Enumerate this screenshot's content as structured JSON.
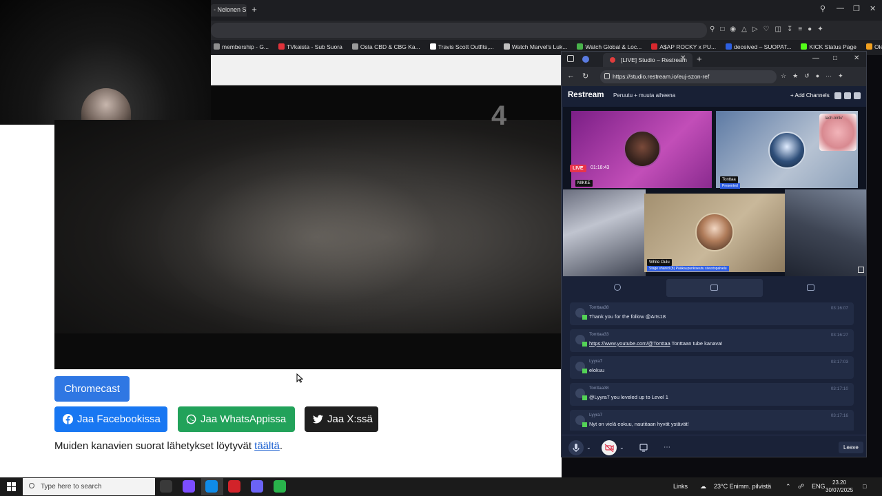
{
  "background_browser": {
    "tab_title": "- Nelonen Su",
    "bookmarks": [
      {
        "label": "membership - G...",
        "color": "#8e8e8e"
      },
      {
        "label": "TVkaista - Sub Suora",
        "color": "#e0323a"
      },
      {
        "label": "Osta CBD & CBG Ka...",
        "color": "#9a9a9a"
      },
      {
        "label": "Travis Scott Outfits,...",
        "color": "#ffffff"
      },
      {
        "label": "Watch Marvel's Luk...",
        "color": "#bfbfbf"
      },
      {
        "label": "Watch Global & Loc...",
        "color": "#49b34b"
      },
      {
        "label": "A$AP ROCKY x PU...",
        "color": "#d8282e"
      },
      {
        "label": "deceived – SUOPAT...",
        "color": "#2d5fe0"
      },
      {
        "label": "KICK Status Page",
        "color": "#53fc18"
      },
      {
        "label": "Oleksandr Usyk vs D...",
        "color": "#f0a020"
      }
    ]
  },
  "video": {
    "channel_number": "4"
  },
  "page": {
    "chromecast_label": "Chromecast",
    "share_facebook": "Jaa Facebookissa",
    "share_whatsapp": "Jaa WhatsAppissa",
    "share_x": "Jaa X:ssä",
    "other_channels_text": "Muiden kanavien suorat lähetykset löytyvät ",
    "other_channels_link": "täältä",
    "other_channels_period": "."
  },
  "restream": {
    "tab_title": "[LIVE] Studio – Restream",
    "url": "https://studio.restream.io/euj-szon-ref",
    "logo": "Restream",
    "stream_title": "Peruutu + muuta aiheena",
    "add_channels": "+ Add Channels",
    "live_label": "LIVE",
    "live_time": "01:18:43",
    "pig_caption": "/ach.oink/",
    "participants": [
      {
        "name": "MIKKE",
        "sub": ""
      },
      {
        "name": "Tonttaa",
        "sub": "Presented"
      },
      {
        "name": "White Oulu",
        "sub": "Stage shared (8) Pääkaupunkiseutu sivustopalvelu"
      }
    ],
    "chat": [
      {
        "user": "Tonttaa38",
        "text": "Thank you for the follow @Arts18",
        "link": "",
        "time": "03:16:07"
      },
      {
        "user": "Tonttaa33",
        "text": " Tonttaan tube kanava!",
        "link": "https://www.youtube.com/@Tonttaa",
        "time": "03:16:27"
      },
      {
        "user": "Lyyra7",
        "text": "elokuu",
        "link": "",
        "time": "03:17:03"
      },
      {
        "user": "Tonttaa38",
        "text": "@Lyyra7 you leveled up to Level 1",
        "link": "",
        "time": "03:17:10"
      },
      {
        "user": "Lyyra7",
        "text": "Nyt on vielä eokuu, nautitaan hyvät ystävät!",
        "link": "",
        "time": "03:17:16"
      }
    ],
    "leave_label": "Leave"
  },
  "taskbar": {
    "search_placeholder": "Type here to search",
    "links_label": "Links",
    "weather": "23°C  Enimm. pilvistä",
    "language": "ENG",
    "time": "23.20",
    "date": "30/07/2025",
    "app_colors": [
      "#3a3a3a",
      "#7c4dff",
      "#0f8be8",
      "#d2232a",
      "#6b63f6",
      "#29b34b"
    ]
  }
}
